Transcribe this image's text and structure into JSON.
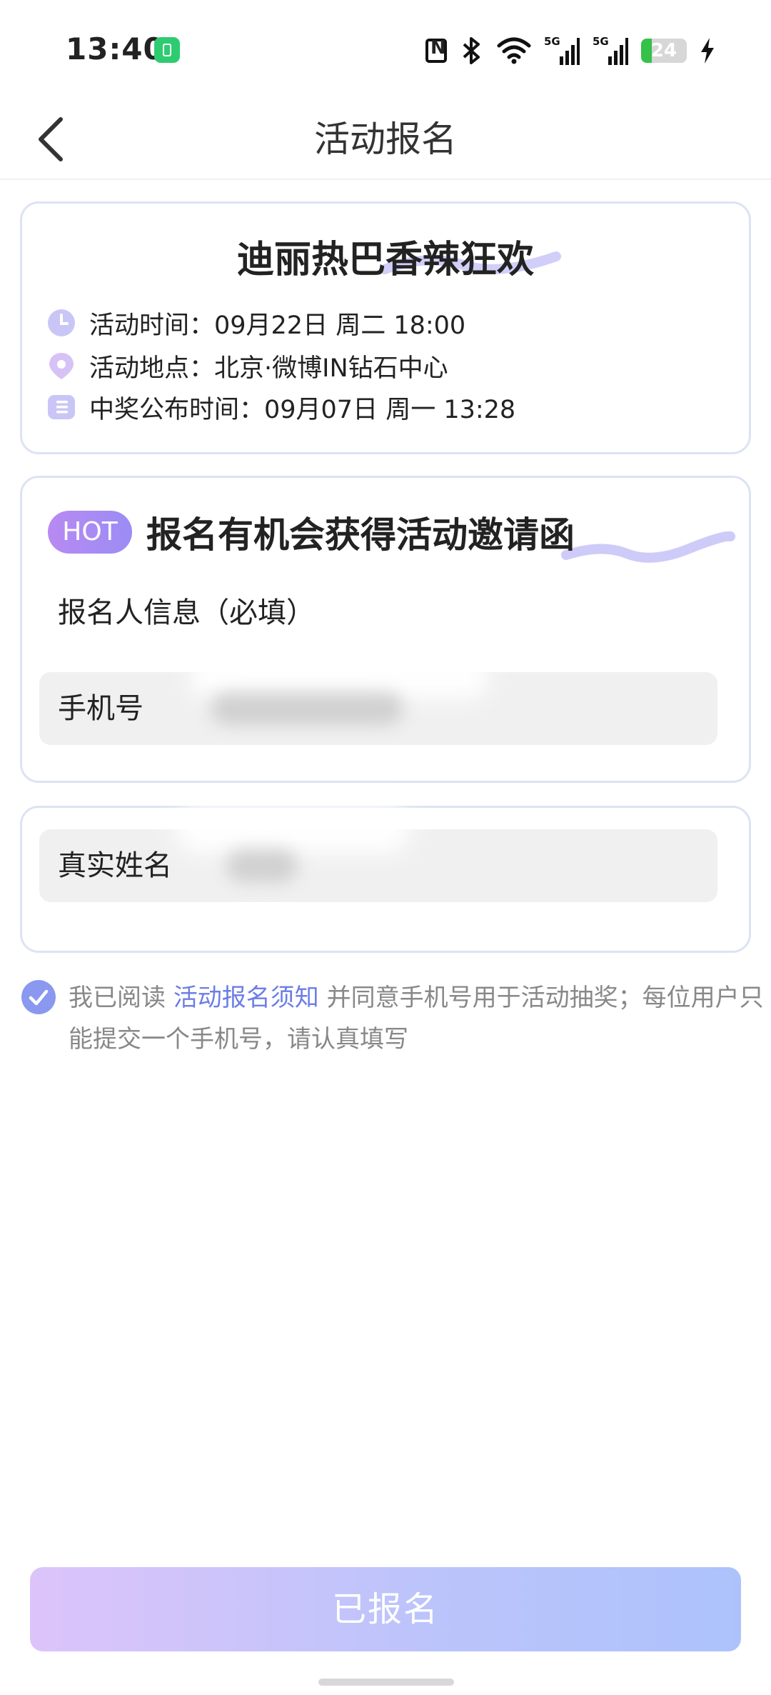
{
  "status_bar": {
    "time": "13:40",
    "network_1": "5G",
    "network_2": "5G",
    "battery_level": "24",
    "battery_fraction": 0.24
  },
  "nav": {
    "title": "活动报名"
  },
  "event": {
    "title": "迪丽热巴香辣狂欢",
    "time": "活动时间：09月22日 周二 18:00",
    "location": "活动地点：北京·微博IN钻石中心",
    "announce": "中奖公布时间：09月07日 周一 13:28"
  },
  "promo": {
    "badge": "HOT",
    "title": "报名有机会获得活动邀请函",
    "section_label": "报名人信息（必填）"
  },
  "form": {
    "phone_label": "手机号",
    "name_label": "真实姓名"
  },
  "agreement": {
    "prefix": "我已阅读 ",
    "link": "活动报名须知",
    "suffix": " 并同意手机号用于活动抽奖；每位用户只能提交一个手机号，请认真填写"
  },
  "submit": {
    "label": "已报名"
  },
  "colors": {
    "accent": "#8a98f0",
    "link": "#6c7ee6",
    "card_border": "#dce3f3"
  }
}
